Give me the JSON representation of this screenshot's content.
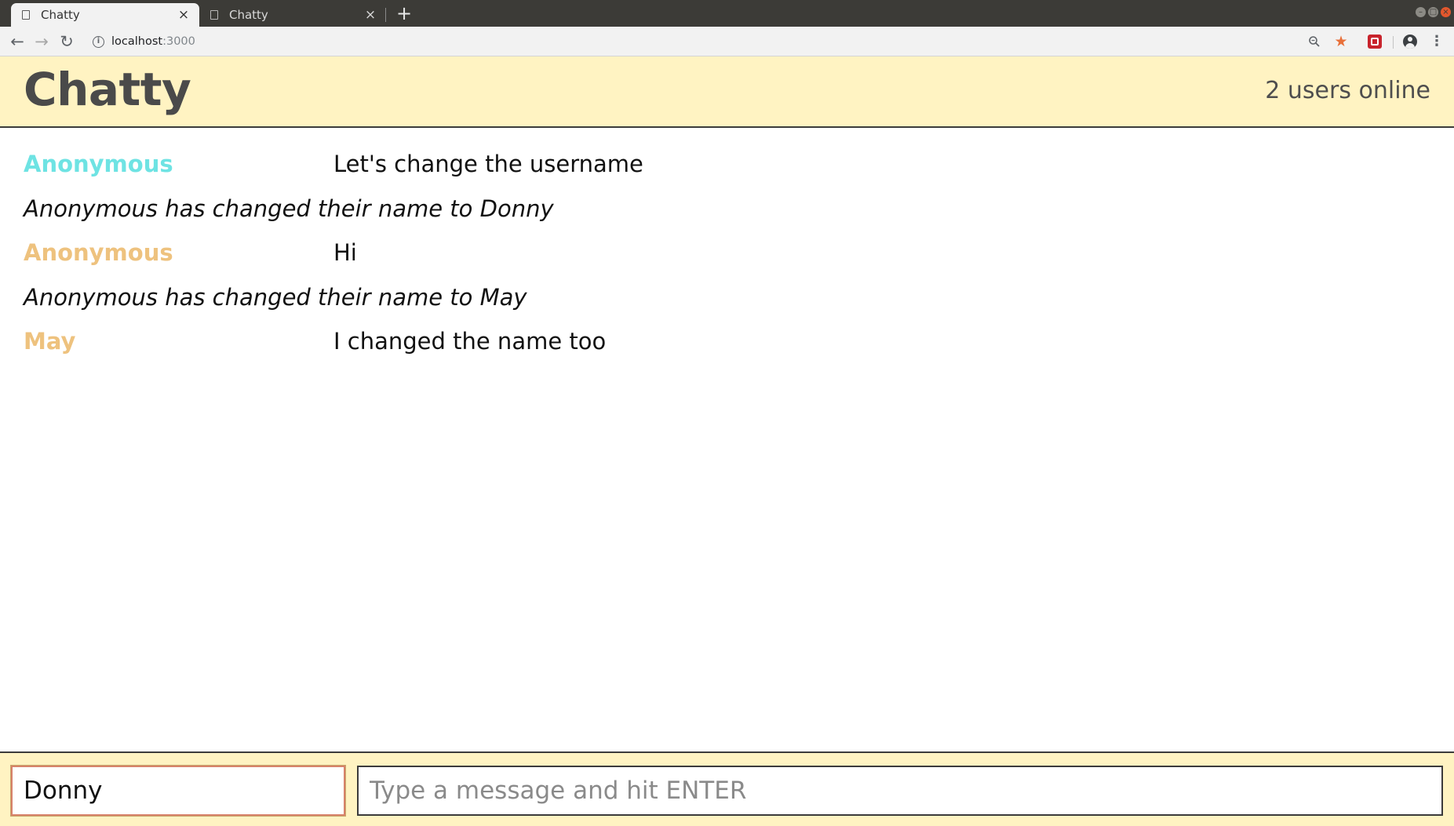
{
  "browser": {
    "tabs": [
      {
        "title": "Chatty",
        "active": true
      },
      {
        "title": "Chatty",
        "active": false
      }
    ],
    "new_tab_glyph": "+",
    "close_glyph": "×",
    "url_host": "localhost",
    "url_port": ":3000",
    "icons": {
      "back": "back-arrow-icon",
      "forward": "forward-arrow-icon",
      "reload": "reload-icon",
      "info": "info-icon",
      "zoom": "zoom-icon",
      "bookmark": "star-icon",
      "extension": "extension-icon",
      "profile": "profile-icon",
      "menu": "kebab-menu-icon"
    },
    "star_color": "#e8703a"
  },
  "app": {
    "title": "Chatty",
    "users_online": "2 users online",
    "header_bg": "#fff3c2"
  },
  "messages": [
    {
      "type": "message",
      "username": "Anonymous",
      "username_color": "#6ee3e3",
      "content": "Let's change the username"
    },
    {
      "type": "notification",
      "content": "Anonymous has changed their name to Donny"
    },
    {
      "type": "message",
      "username": "Anonymous",
      "username_color": "#eec27e",
      "content": "Hi"
    },
    {
      "type": "notification",
      "content": "Anonymous has changed their name to May"
    },
    {
      "type": "message",
      "username": "May",
      "username_color": "#eec27e",
      "content": "I changed the name too"
    }
  ],
  "chatbar": {
    "username_value": "Donny",
    "message_placeholder": "Type a message and hit ENTER",
    "message_value": ""
  }
}
